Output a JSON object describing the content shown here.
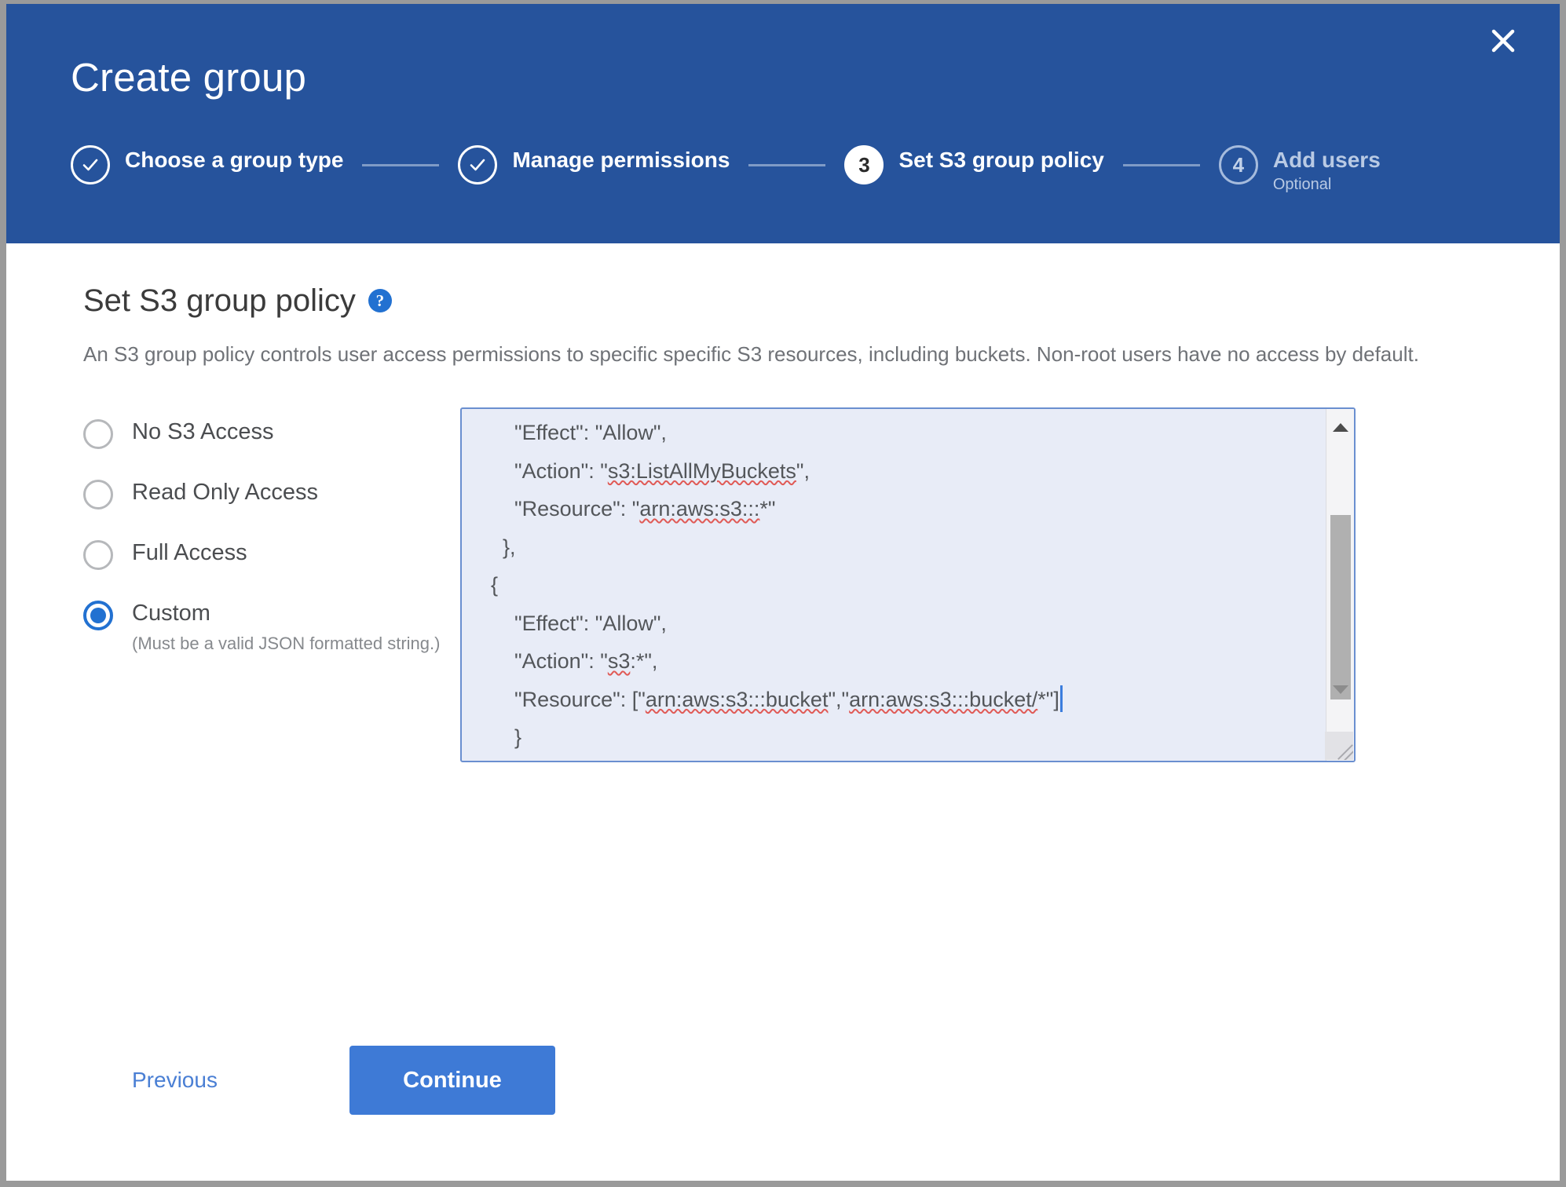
{
  "window": {
    "title": "Create group",
    "close_label": "×"
  },
  "stepper": {
    "steps": [
      {
        "marker": "✓",
        "label": "Choose a group type",
        "sub": "",
        "state": "done"
      },
      {
        "marker": "✓",
        "label": "Manage permissions",
        "sub": "",
        "state": "done"
      },
      {
        "marker": "3",
        "label": "Set S3 group policy",
        "sub": "",
        "state": "active"
      },
      {
        "marker": "4",
        "label": "Add users",
        "sub": "Optional",
        "state": "upcoming"
      }
    ]
  },
  "main": {
    "section_title": "Set S3 group policy",
    "help_icon_label": "?",
    "description": "An S3 group policy controls user access permissions to specific specific S3 resources, including buckets. Non-root users have no access by default.",
    "options": [
      {
        "label": "No S3 Access",
        "hint": "",
        "selected": false
      },
      {
        "label": "Read Only Access",
        "hint": "",
        "selected": false
      },
      {
        "label": "Full Access",
        "hint": "",
        "selected": false
      },
      {
        "label": "Custom",
        "hint": "(Must be a valid JSON formatted string.)",
        "selected": true
      }
    ],
    "policy_editor": {
      "lines": [
        "      \"Effect\": \"Allow\",",
        "      \"Action\": \"s3:ListAllMyBuckets\",",
        "      \"Resource\": \"arn:aws:s3:::*\"",
        "    },",
        "  {",
        "      \"Effect\": \"Allow\",",
        "      \"Action\": \"s3:*\",",
        "      \"Resource\": [\"arn:aws:s3:::bucket\",\"arn:aws:s3:::bucket/*\"]",
        "      }",
        "    ]",
        "  }"
      ],
      "scroll_up_label": "▲",
      "scroll_down_label": "▼"
    }
  },
  "footer": {
    "previous_label": "Previous",
    "continue_label": "Continue"
  },
  "colors": {
    "header_blue": "#26539c",
    "accent_blue": "#2271d1",
    "button_blue": "#3e7ad6",
    "textarea_bg": "#e8ecf7",
    "textarea_border": "#6a8fd0"
  }
}
